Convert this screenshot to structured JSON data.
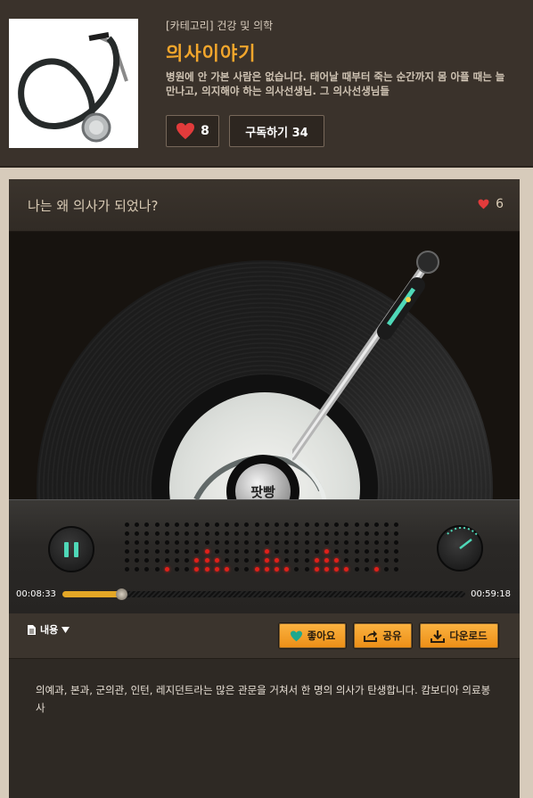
{
  "podcast": {
    "category": "[카테고리] 건강 및 의학",
    "title": "의사이야기",
    "description": "병원에 안 가본 사람은 없습니다. 태어날 때부터 죽는 순간까지 몸 아플 때는 늘 만나고, 의지해야 하는 의사선생님. 그 의사선생님들",
    "likes": "8",
    "subscribe_label": "구독하기 34"
  },
  "episode": {
    "title": "나는 왜 의사가 되었나?",
    "likes": "6"
  },
  "player": {
    "brand": "팟빵",
    "current_time": "00:08:33",
    "total_time": "00:59:18",
    "progress": 0.146,
    "state": "playing",
    "eq_levels": [
      0,
      0,
      0,
      0,
      1,
      0,
      0,
      2,
      3,
      2,
      1,
      0,
      0,
      1,
      3,
      2,
      1,
      0,
      0,
      2,
      3,
      2,
      1,
      0,
      0,
      1,
      0,
      0
    ]
  },
  "actions": {
    "content_label": "내용",
    "like_label": "좋아요",
    "share_label": "공유",
    "download_label": "다운로드"
  },
  "body_text": "의예과, 본과, 군의관, 인턴, 레지던트라는 많은 관문을 거쳐서 한 명의 의사가 탄생합니다. 캄보디아 의료봉사",
  "colors": {
    "accent": "#f2a62c",
    "heart": "#e23b3b",
    "teal": "#4fd8b8",
    "led_red": "#e0201a"
  }
}
